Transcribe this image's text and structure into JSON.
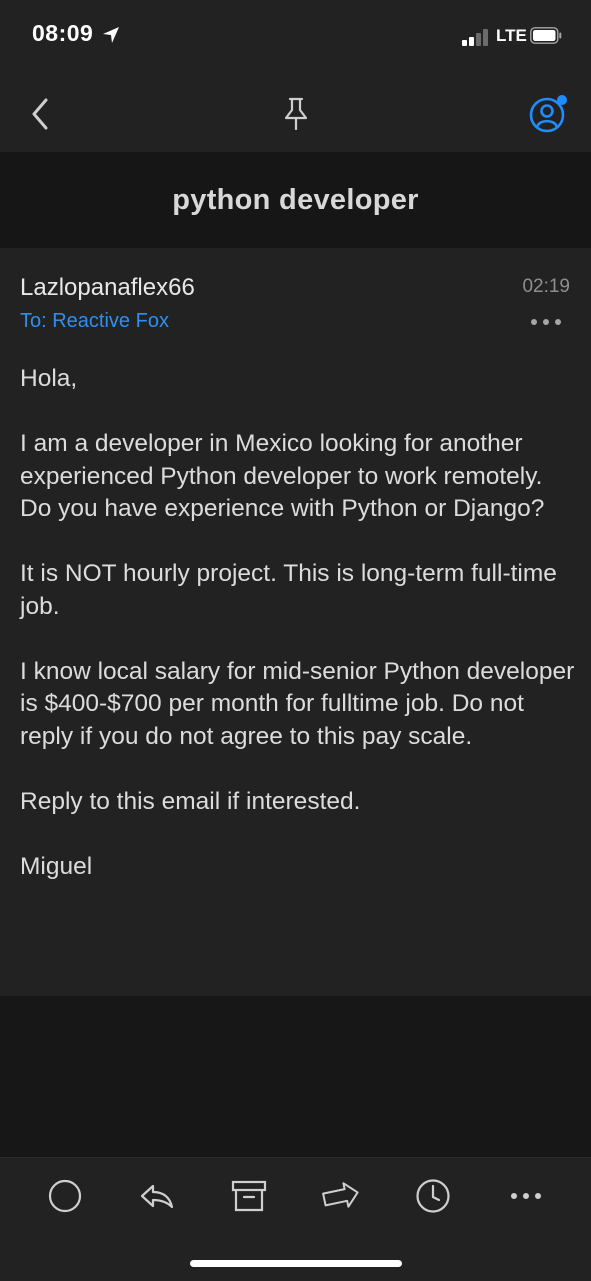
{
  "status_bar": {
    "time": "08:09",
    "carrier": "LTE",
    "location_icon": "location-arrow-icon",
    "signal_icon": "signal-bars-icon",
    "battery_icon": "battery-icon"
  },
  "nav": {
    "back_icon": "chevron-left-icon",
    "pin_icon": "pin-icon",
    "account_icon": "account-icon",
    "accent_color": "#1f8cff"
  },
  "subject": "python developer",
  "message": {
    "sender": "Lazlopanaflex66",
    "time": "02:19",
    "recipient": "To: Reactive Fox",
    "body": [
      "Hola,",
      "I am a developer in Mexico looking for another experienced Python developer to work remotely. Do you have experience with Python or Django?",
      "It is NOT hourly project. This is long-term full-time job.",
      "I know local salary for mid-senior Python developer is $400-$700 per month for fulltime job. Do not reply if you do not agree to this pay scale.",
      "Reply to this email if interested.",
      "Miguel"
    ]
  },
  "toolbar": {
    "items": [
      {
        "icon": "circle-icon"
      },
      {
        "icon": "reply-icon"
      },
      {
        "icon": "archive-icon"
      },
      {
        "icon": "forward-icon"
      },
      {
        "icon": "clock-icon"
      },
      {
        "icon": "more-icon"
      }
    ]
  }
}
